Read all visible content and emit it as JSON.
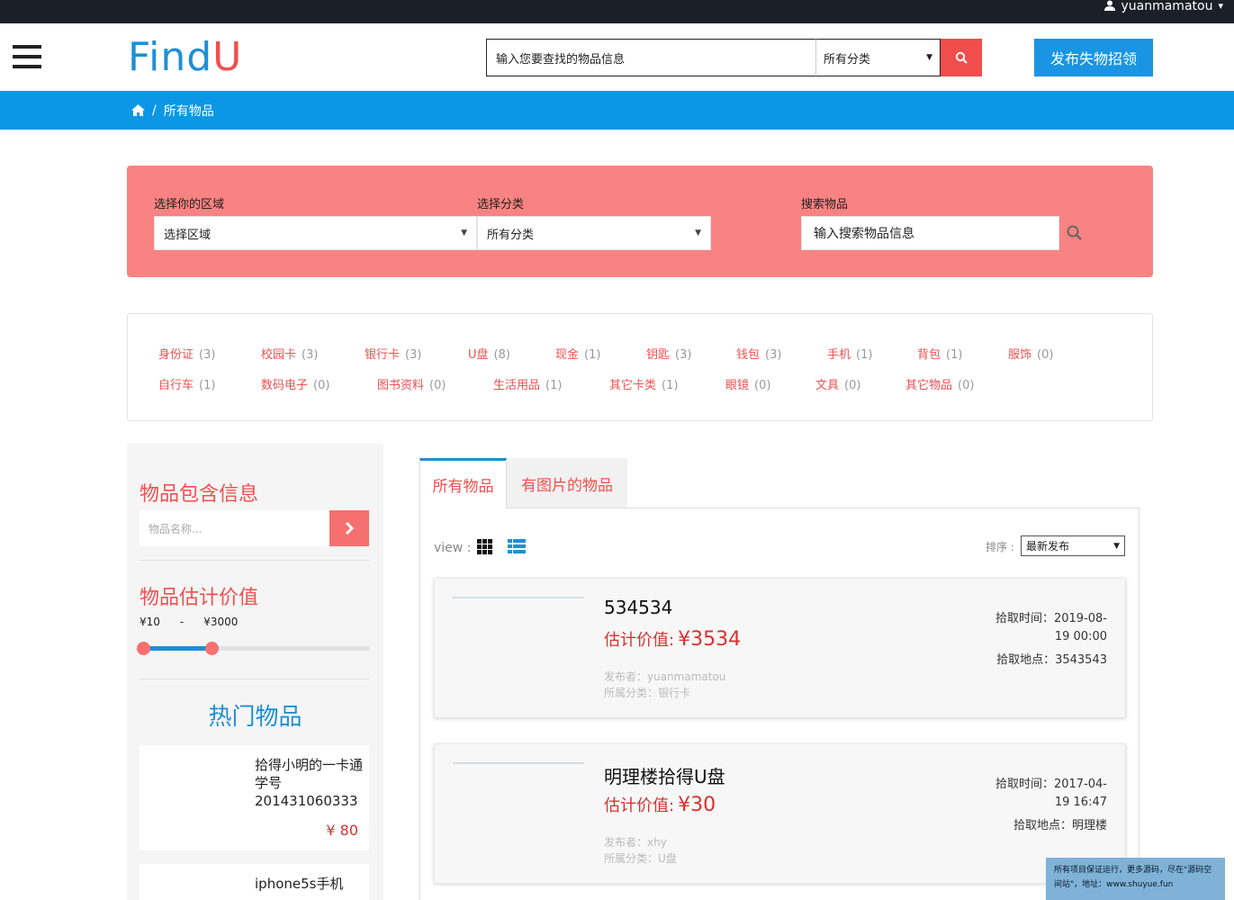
{
  "topbar": {
    "username": "yuanmamatou",
    "caret": "▾"
  },
  "header": {
    "logo_main": "Find",
    "logo_accent": "U",
    "search_placeholder": "输入您要查找的物品信息",
    "category_select": "所有分类",
    "publish_label": "发布失物招领"
  },
  "breadcrumb": {
    "separator": "/",
    "current": "所有物品"
  },
  "filter": {
    "region_label": "选择你的区域",
    "region_value": "选择区域",
    "category_label": "选择分类",
    "category_value": "所有分类",
    "search_label": "搜索物品",
    "search_placeholder": "输入搜索物品信息"
  },
  "categories": [
    {
      "name": "身份证",
      "count": "(3)"
    },
    {
      "name": "校园卡",
      "count": "(3)"
    },
    {
      "name": "银行卡",
      "count": "(3)"
    },
    {
      "name": "U盘",
      "count": "(8)"
    },
    {
      "name": "现金",
      "count": "(1)"
    },
    {
      "name": "钥匙",
      "count": "(3)"
    },
    {
      "name": "钱包",
      "count": "(3)"
    },
    {
      "name": "手机",
      "count": "(1)"
    },
    {
      "name": "背包",
      "count": "(1)"
    },
    {
      "name": "服饰",
      "count": "(0)"
    },
    {
      "name": "自行车",
      "count": "(1)"
    },
    {
      "name": "数码电子",
      "count": "(0)"
    },
    {
      "name": "图书资料",
      "count": "(0)"
    },
    {
      "name": "生活用品",
      "count": "(1)"
    },
    {
      "name": "其它卡类",
      "count": "(1)"
    },
    {
      "name": "眼镜",
      "count": "(0)"
    },
    {
      "name": "文具",
      "count": "(0)"
    },
    {
      "name": "其它物品",
      "count": "(0)"
    }
  ],
  "sidebar": {
    "info_title": "物品包含信息",
    "name_placeholder": "物品名称...",
    "value_title": "物品估计价值",
    "price_min": "¥10",
    "price_dash": "-",
    "price_max": "¥3000",
    "slider_low": 0,
    "slider_high": 0.3,
    "hot_title": "热门物品",
    "hot_items": [
      {
        "title": "拾得小明的一卡通 学号201431060333",
        "price": "¥ 80"
      },
      {
        "title": "iphone5s手机",
        "price": ""
      }
    ]
  },
  "main": {
    "tabs": [
      "所有物品",
      "有图片的物品"
    ],
    "view_label": "view :",
    "sort_label": "排序 :",
    "sort_value": "最新发布",
    "items": [
      {
        "title": "534534",
        "price_label": "估计价值:",
        "price": "¥3534",
        "publisher": "发布者：yuanmamatou",
        "category": "所属分类：银行卡",
        "time_label": "拾取时间：2019-08-19 00:00",
        "place_label": "拾取地点：3543543"
      },
      {
        "title": "明理楼拾得U盘",
        "price_label": "估计价值:",
        "price": "¥30",
        "publisher": "发布者：xhy",
        "category": "所属分类：U盘",
        "time_label": "拾取时间：2017-04-19 16:47",
        "place_label": "拾取地点：明理楼"
      }
    ]
  },
  "watermark": {
    "line1": "所有项目保证运行，更多源码，尽在\"源码空间站\"，地址：www.shuyue.fun"
  },
  "colors": {
    "accent": "#1e8fd6",
    "brand_red": "#f0504f",
    "filter_bg": "#f98382",
    "bar": "#0c96e6"
  }
}
